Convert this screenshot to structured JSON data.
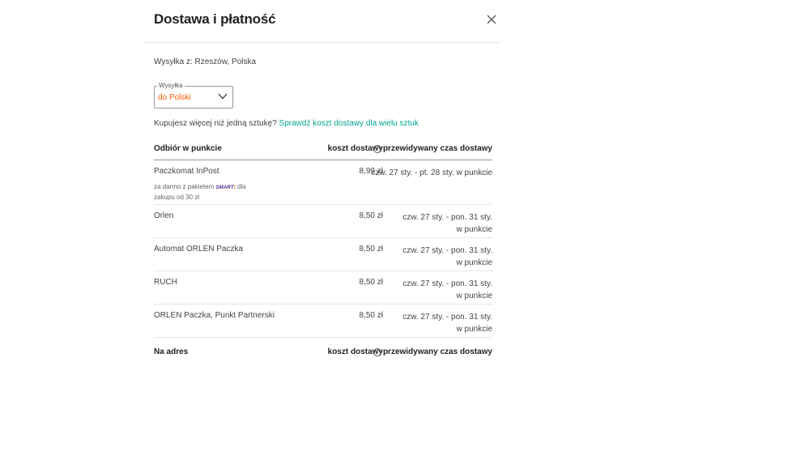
{
  "modal": {
    "title": "Dostawa i płatność",
    "close_icon": "close-icon"
  },
  "ship_from": "Wysyłka z: Rzeszów, Polska",
  "shipping_select": {
    "legend": "Wysyłka",
    "value": "do Polski",
    "icon": "chevron-down-icon"
  },
  "multi": {
    "question": "Kupujesz więcej niż jedną sztukę?",
    "link": "Sprawdź koszt dostawy dla wielu sztuk"
  },
  "pickup": {
    "header": {
      "name": "Odbiór w punkcie",
      "cost": "koszt dostawy",
      "time": "przewidywany czas dostawy",
      "info_icon": "info-icon"
    },
    "rows": [
      {
        "name": "Paczkomat InPost",
        "price": "8,99 zł",
        "time_line1": "czw. 27 sty. - pt. 28 sty. w punkcie",
        "time_line2": "",
        "note_before": "za darmo z pakietem",
        "note_badge": "SMART",
        "note_badge_mark": "!",
        "note_after": "dla",
        "note_line2": "zakupu od 30 zł"
      },
      {
        "name": "Orlen",
        "price": "8,50 zł",
        "time_line1": "czw. 27 sty. - pon. 31 sty.",
        "time_line2": "w punkcie"
      },
      {
        "name": "Automat ORLEN Paczka",
        "price": "8,50 zł",
        "time_line1": "czw. 27 sty. - pon. 31 sty.",
        "time_line2": "w punkcie"
      },
      {
        "name": "RUCH",
        "price": "8,50 zł",
        "time_line1": "czw. 27 sty. - pon. 31 sty.",
        "time_line2": "w punkcie"
      },
      {
        "name": "ORLEN Paczka, Punkt Partnerski",
        "price": "8,50 zł",
        "time_line1": "czw. 27 sty. - pon. 31 sty.",
        "time_line2": "w punkcie"
      }
    ]
  },
  "address": {
    "header": {
      "name": "Na adres",
      "cost": "koszt dostawy",
      "time": "przewidywany czas dostawy",
      "info_icon": "info-icon"
    }
  },
  "colors": {
    "accent_orange": "#ff5a00",
    "link_teal": "#00a790",
    "smart_purple": "#4a2a87"
  }
}
